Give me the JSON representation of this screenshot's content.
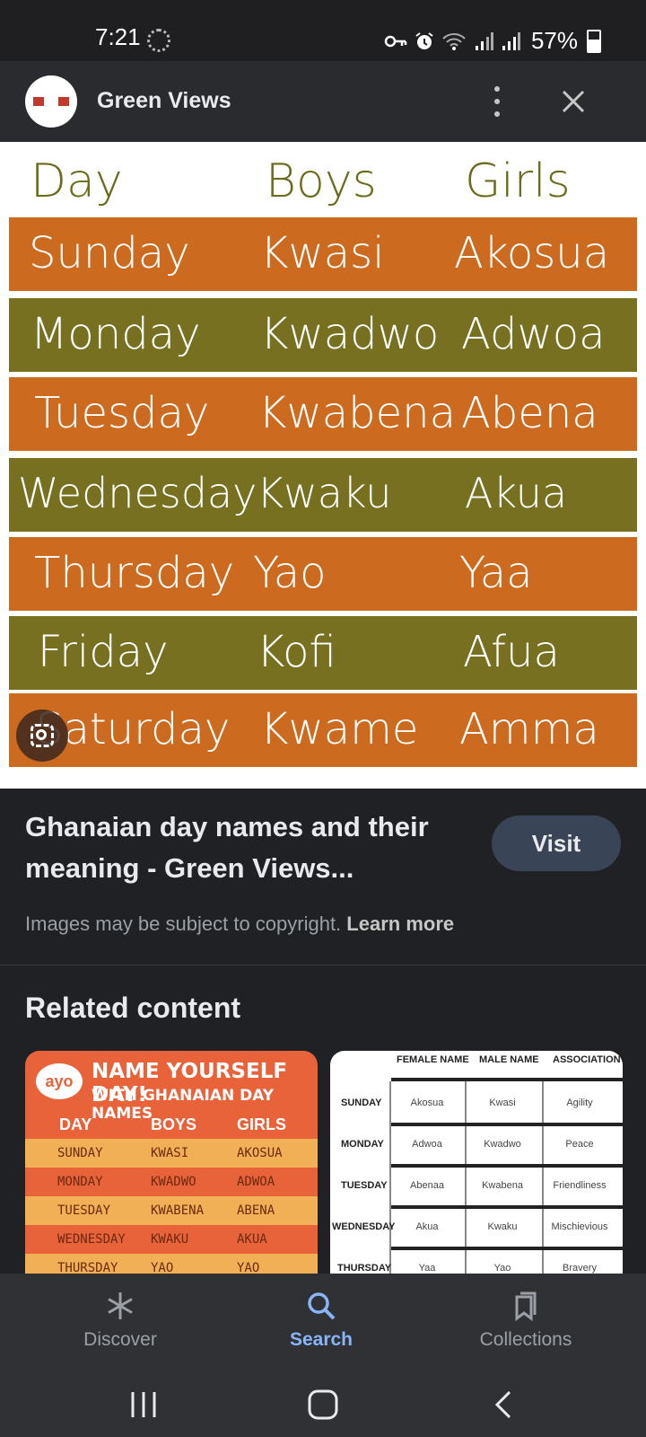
{
  "status_bar": {
    "time": "7:21",
    "battery": "57%"
  },
  "header": {
    "site_name": "Green Views",
    "more_icon": "more-vert-icon",
    "close_icon": "close-icon"
  },
  "image": {
    "headers": [
      "Day",
      "Boys",
      "Girls"
    ],
    "rows": [
      {
        "day": "Sunday",
        "boy": "Kwasi",
        "girl": "Akosua",
        "color": "#cc6a1f"
      },
      {
        "day": "Monday",
        "boy": "Kwadwo",
        "girl": "Adwoa",
        "color": "#767020"
      },
      {
        "day": "Tuesday",
        "boy": "Kwabena",
        "girl": "Abena",
        "color": "#cc6a1f"
      },
      {
        "day": "Wednesday",
        "boy": "Kwaku",
        "girl": "Akua",
        "color": "#767020"
      },
      {
        "day": "Thursday",
        "boy": "Yao",
        "girl": "Yaa",
        "color": "#cc6a1f"
      },
      {
        "day": "Friday",
        "boy": "Kofi",
        "girl": "Afua",
        "color": "#767020"
      },
      {
        "day": "Saturday",
        "boy": "Kwame",
        "girl": "Amma",
        "color": "#cc6a1f"
      }
    ]
  },
  "result": {
    "title": "Ghanaian day names and their meaning - Green Views...",
    "visit_label": "Visit",
    "copyright_text": "Images may be subject to copyright.",
    "learn_more": "Learn more"
  },
  "related": {
    "title": "Related content",
    "card1": {
      "logo": "ayo",
      "title": "NAME YOURSELF DAY!",
      "subtitle": "WITH GHANAIAN DAY NAMES",
      "headers": [
        "DAY",
        "BOYS",
        "GIRLS"
      ],
      "rows": [
        [
          "SUNDAY",
          "KWASI",
          "AKOSUA"
        ],
        [
          "MONDAY",
          "KWADWO",
          "ADWOA"
        ],
        [
          "TUESDAY",
          "KWABENA",
          "ABENA"
        ],
        [
          "WEDNESDAY",
          "KWAKU",
          "AKUA"
        ],
        [
          "THURSDAY",
          "YAO",
          "YAO"
        ]
      ]
    },
    "card2": {
      "headers": [
        "FEMALE NAME",
        "MALE NAME",
        "ASSOCIATION"
      ],
      "rows": [
        [
          "SUNDAY",
          "Akosua",
          "Kwasi",
          "Agility"
        ],
        [
          "MONDAY",
          "Adwoa",
          "Kwadwo",
          "Peace"
        ],
        [
          "TUESDAY",
          "Abenaa",
          "Kwabena",
          "Friendliness"
        ],
        [
          "WEDNESDAY",
          "Akua",
          "Kwaku",
          "Mischievious"
        ],
        [
          "THURSDAY",
          "Yaa",
          "Yao",
          "Bravery"
        ]
      ]
    }
  },
  "bottom_nav": [
    {
      "label": "Discover",
      "icon": "asterisk-icon",
      "active": false
    },
    {
      "label": "Search",
      "icon": "search-icon",
      "active": true
    },
    {
      "label": "Collections",
      "icon": "collections-icon",
      "active": false
    }
  ],
  "colors": {
    "accent": "#8ab4f8",
    "orange": "#cc6a1f",
    "olive": "#767020"
  }
}
